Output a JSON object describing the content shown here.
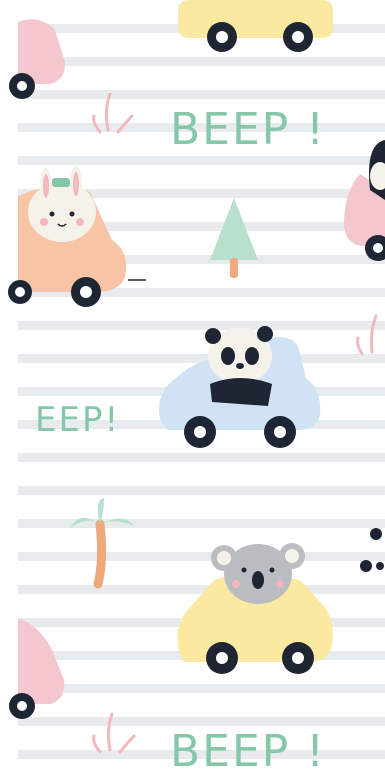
{
  "pattern": {
    "text_1": "BEEP !",
    "text_2": "EEP!",
    "text_3": "BEEP !"
  },
  "colors": {
    "stripe": "#e1e4e7",
    "text_green": "#86c7a9",
    "car_yellow": "#fbe9a2",
    "car_peach": "#f7c4a5",
    "car_blue": "#cfe3f4",
    "car_pink": "#f4c6cd",
    "tree_green": "#b8e0cd",
    "trunk_orange": "#eeaa7c",
    "wheel_dark": "#1f2633"
  },
  "icons": [
    "yellow-car-icon",
    "bunny-car-icon",
    "panda-car-icon",
    "koala-car-icon",
    "pine-tree-icon",
    "palm-tree-icon",
    "grass-tuft-icon"
  ]
}
